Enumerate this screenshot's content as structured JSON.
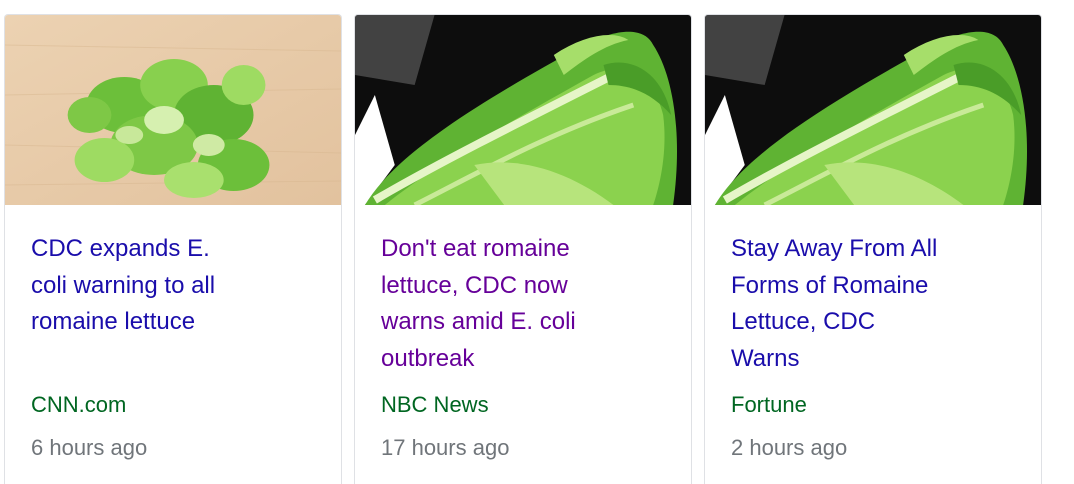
{
  "cards": [
    {
      "image": "chopped-lettuce-on-cutting-board",
      "headline": "CDC expands E. coli warning to all romaine lettuce",
      "headline_lines": [
        "CDC expands E.",
        "coli warning to all",
        "romaine lettuce"
      ],
      "source": "CNN.com",
      "time": "6 hours ago",
      "visited": false
    },
    {
      "image": "romaine-lettuce-head",
      "headline": "Don't eat romaine lettuce, CDC now warns amid E. coli outbreak",
      "headline_lines": [
        "Don't eat romaine",
        "lettuce, CDC now",
        "warns amid E. coli",
        "outbreak"
      ],
      "source": "NBC News",
      "time": "17 hours ago",
      "visited": true
    },
    {
      "image": "romaine-lettuce-head",
      "headline": "Stay Away From All Forms of Romaine Lettuce, CDC Warns",
      "headline_lines": [
        "Stay Away From All",
        "Forms of Romaine",
        "Lettuce, CDC",
        "Warns"
      ],
      "source": "Fortune",
      "time": "2 hours ago",
      "visited": false
    }
  ],
  "colors": {
    "link": "#1a0dab",
    "visited_link": "#660099",
    "source": "#006621",
    "time": "#70757a",
    "card_border": "#dfe1e5"
  }
}
